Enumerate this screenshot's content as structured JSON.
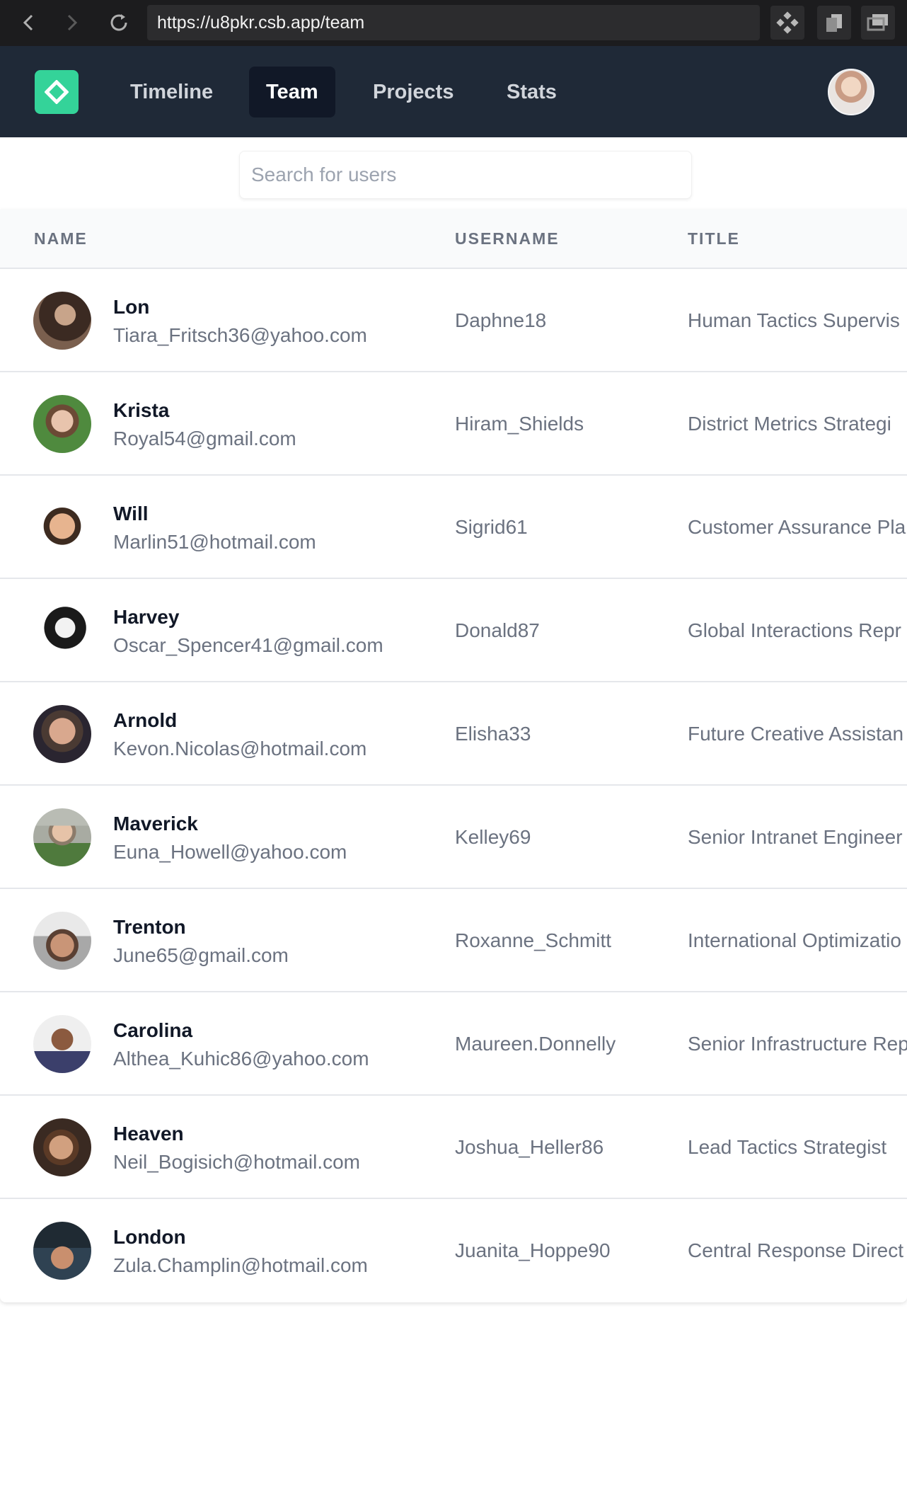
{
  "browser": {
    "url": "https://u8pkr.csb.app/team"
  },
  "nav": {
    "links": [
      {
        "label": "Timeline",
        "active": false
      },
      {
        "label": "Team",
        "active": true
      },
      {
        "label": "Projects",
        "active": false
      },
      {
        "label": "Stats",
        "active": false
      }
    ]
  },
  "search": {
    "placeholder": "Search for users",
    "value": ""
  },
  "table": {
    "columns": [
      "NAME",
      "USERNAME",
      "TITLE"
    ],
    "rows": [
      {
        "name": "Lon",
        "email": "Tiara_Fritsch36@yahoo.com",
        "username": "Daphne18",
        "title": "Human Tactics Supervis"
      },
      {
        "name": "Krista",
        "email": "Royal54@gmail.com",
        "username": "Hiram_Shields",
        "title": "District Metrics Strategi"
      },
      {
        "name": "Will",
        "email": "Marlin51@hotmail.com",
        "username": "Sigrid61",
        "title": "Customer Assurance Pla"
      },
      {
        "name": "Harvey",
        "email": "Oscar_Spencer41@gmail.com",
        "username": "Donald87",
        "title": "Global Interactions Repr"
      },
      {
        "name": "Arnold",
        "email": "Kevon.Nicolas@hotmail.com",
        "username": "Elisha33",
        "title": "Future Creative Assistan"
      },
      {
        "name": "Maverick",
        "email": "Euna_Howell@yahoo.com",
        "username": "Kelley69",
        "title": "Senior Intranet Engineer"
      },
      {
        "name": "Trenton",
        "email": "June65@gmail.com",
        "username": "Roxanne_Schmitt",
        "title": "International Optimizatio"
      },
      {
        "name": "Carolina",
        "email": "Althea_Kuhic86@yahoo.com",
        "username": "Maureen.Donnelly",
        "title": "Senior Infrastructure Rep"
      },
      {
        "name": "Heaven",
        "email": "Neil_Bogisich@hotmail.com",
        "username": "Joshua_Heller86",
        "title": "Lead Tactics Strategist"
      },
      {
        "name": "London",
        "email": "Zula.Champlin@hotmail.com",
        "username": "Juanita_Hoppe90",
        "title": "Central Response Direct"
      }
    ]
  },
  "colors": {
    "header_bg": "#1f2937",
    "accent": "#34d399",
    "active_nav_bg": "#111827"
  }
}
